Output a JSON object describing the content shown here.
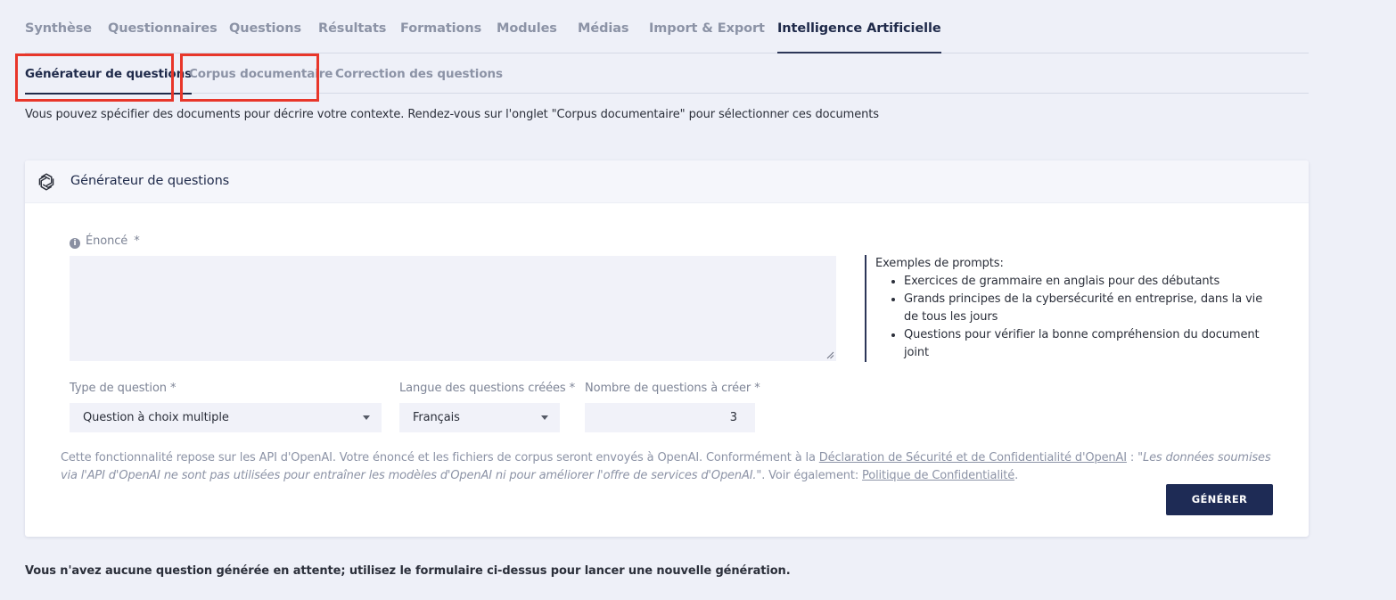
{
  "tabs_main": [
    {
      "label": "Synthèse",
      "active": false
    },
    {
      "label": "Questionnaires",
      "active": false
    },
    {
      "label": "Questions",
      "active": false
    },
    {
      "label": "Résultats",
      "active": false
    },
    {
      "label": "Formations",
      "active": false
    },
    {
      "label": "Modules",
      "active": false
    },
    {
      "label": "Médias",
      "active": false
    },
    {
      "label": "Import & Export",
      "active": false
    },
    {
      "label": "Intelligence Artificielle",
      "active": true
    }
  ],
  "tabs_sub": [
    {
      "label": "Générateur de questions",
      "active": true
    },
    {
      "label": "Corpus documentaire",
      "active": false
    },
    {
      "label": "Correction des questions",
      "active": false
    }
  ],
  "info_text": "Vous pouvez spécifier des documents pour décrire votre contexte. Rendez-vous sur l'onglet \"Corpus documentaire\" pour sélectionner ces documents",
  "generator": {
    "title": "Générateur de questions",
    "icon": "openai-icon",
    "enonce_label": "Énoncé",
    "required_mark": "*",
    "enonce_value": "",
    "examples_title": "Exemples de prompts:",
    "examples": [
      "Exercices de grammaire en anglais pour des débutants",
      "Grands principes de la cybersécurité en entreprise, dans la vie de tous les jours",
      "Questions pour vérifier la bonne compréhension du document joint"
    ],
    "type_label": "Type de question",
    "type_value": "Question à choix multiple",
    "lang_label": "Langue des questions créées",
    "lang_value": "Français",
    "count_label": "Nombre de questions à créer",
    "count_value": "3",
    "disclaimer_1": "Cette fonctionnalité repose sur les API d'OpenAI. Votre énoncé et les fichiers de corpus seront envoyés à OpenAI. Conformément à la ",
    "disclaimer_link1": "Déclaration de Sécurité et de Confidentialité d'OpenAI",
    "disclaimer_2": " : ",
    "disclaimer_quote": "\"Les données soumises via l'API d'OpenAI ne sont pas utilisées pour entraîner les modèles d'OpenAI ni pour améliorer l'offre de services d'OpenAI.\"",
    "disclaimer_3": ". Voir également: ",
    "disclaimer_link2": "Politique de Confidentialité",
    "disclaimer_4": ".",
    "generate_label": "GÉNÉRER"
  },
  "pending_text": "Vous n'avez aucune question générée en attente; utilisez le formulaire ci-dessus pour lancer une nouvelle génération.",
  "colors": {
    "highlight_box": "#e8362a",
    "primary_button": "#1e2b55",
    "background": "#eef0f8"
  }
}
